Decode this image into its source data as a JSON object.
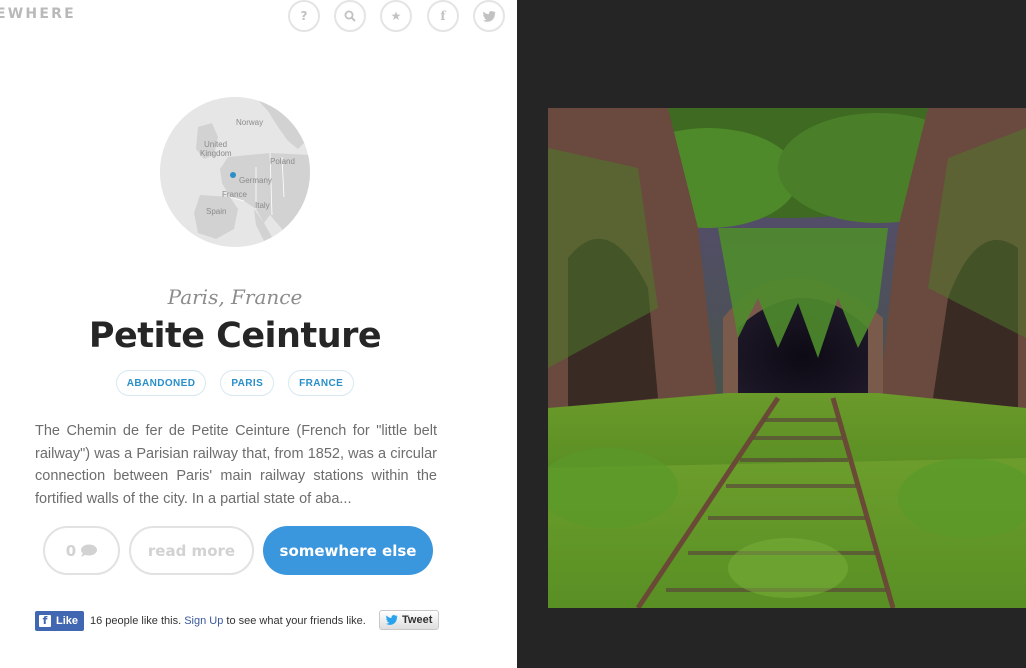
{
  "header": {
    "logo_text": "EWHERE",
    "icons": [
      {
        "name": "help-icon",
        "glyph": "?"
      },
      {
        "name": "search-icon",
        "glyph": "⌕"
      },
      {
        "name": "star-icon",
        "glyph": "★"
      },
      {
        "name": "facebook-icon",
        "glyph": "f"
      },
      {
        "name": "twitter-icon",
        "glyph": "t"
      }
    ]
  },
  "map": {
    "labels": [
      "Norway",
      "United",
      "Kingdom",
      "Poland",
      "Germany",
      "France",
      "Italy",
      "Spain"
    ],
    "marker_color": "#2a8fc9"
  },
  "place": {
    "location": "Paris, France",
    "title": "Petite Ceinture",
    "tags": [
      "ABANDONED",
      "PARIS",
      "FRANCE"
    ],
    "description": "The Chemin de fer de Petite Ceinture (French for \"little belt railway\") was a Parisian railway that, from 1852, was a circular connection between Paris' main railway stations within the fortified walls of the city. In a partial state of aba..."
  },
  "actions": {
    "comment_count": "0",
    "read_more": "read more",
    "somewhere_else": "somewhere else"
  },
  "social": {
    "like_label": "Like",
    "like_text_before": "16 people like this.",
    "signup": "Sign Up",
    "like_text_after": "to see what your friends like.",
    "tweet_label": "Tweet"
  },
  "colors": {
    "accent": "#3a96dd",
    "right_panel_bg": "#252525",
    "facebook_blue": "#4267b2"
  }
}
